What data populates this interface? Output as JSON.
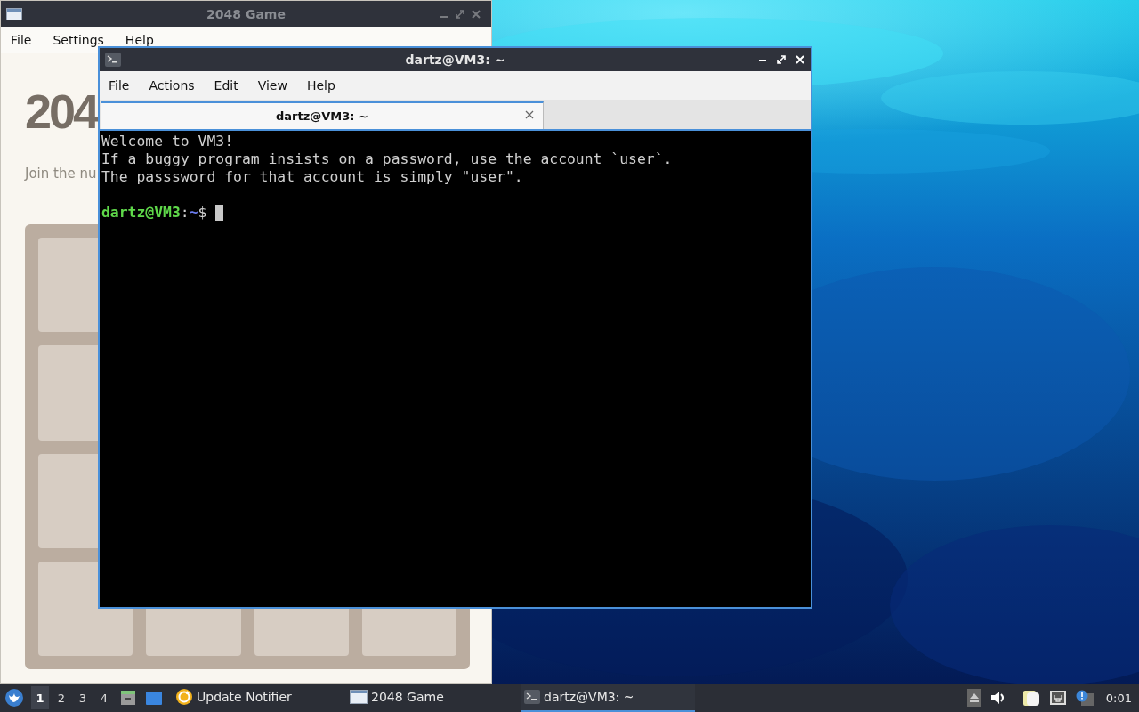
{
  "game_window": {
    "title": "2048 Game",
    "menu": [
      "File",
      "Settings",
      "Help"
    ],
    "heading": "204",
    "intro": "Join the nu"
  },
  "terminal": {
    "title": "dartz@VM3: ~",
    "menu": [
      "File",
      "Actions",
      "Edit",
      "View",
      "Help"
    ],
    "tabs": [
      {
        "label": "dartz@VM3: ~",
        "selected": true
      }
    ],
    "lines": [
      "Welcome to VM3!",
      "If a buggy program insists on a password, use the account `user`.",
      "The passsword for that account is simply \"user\"."
    ],
    "prompt": {
      "user_host": "dartz@VM3",
      "separator": ":",
      "path": "~",
      "symbol": "$"
    }
  },
  "taskbar": {
    "workspaces": [
      {
        "label": "1",
        "selected": true
      },
      {
        "label": "2",
        "selected": false
      },
      {
        "label": "3",
        "selected": false
      },
      {
        "label": "4",
        "selected": false
      }
    ],
    "tasks": [
      {
        "label": "Update Notifier",
        "kind": "update",
        "selected": false
      },
      {
        "label": "2048 Game",
        "kind": "window",
        "selected": false
      },
      {
        "label": "dartz@VM3: ~",
        "kind": "terminal",
        "selected": true
      }
    ],
    "clock": "0:01"
  }
}
